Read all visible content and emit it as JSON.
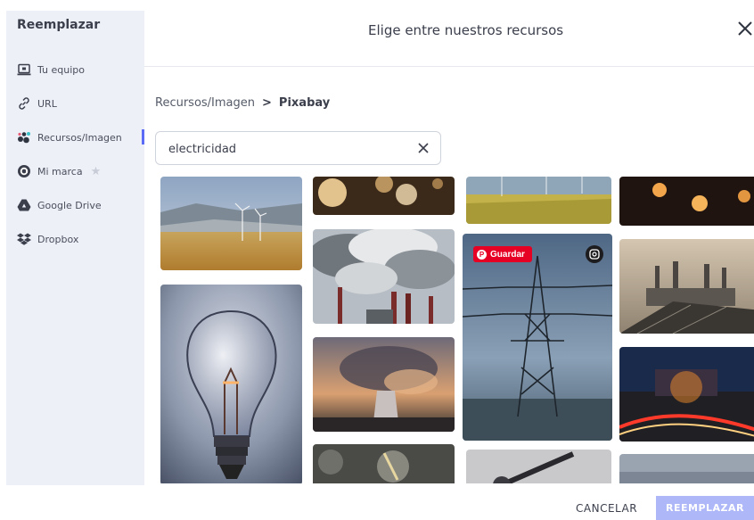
{
  "sidebar": {
    "title": "Reemplazar",
    "items": [
      {
        "label": "Tu equipo",
        "icon": "laptop-icon"
      },
      {
        "label": "URL",
        "icon": "link-icon"
      },
      {
        "label": "Recursos/Imagen",
        "icon": "dots-icon",
        "active": true
      },
      {
        "label": "Mi marca",
        "icon": "brand-icon",
        "badge": "star-icon"
      },
      {
        "label": "Google Drive",
        "icon": "google-drive-icon"
      },
      {
        "label": "Dropbox",
        "icon": "dropbox-icon"
      }
    ]
  },
  "header": {
    "title": "Elige entre nuestros recursos",
    "close_icon": "close-icon"
  },
  "breadcrumb": {
    "parent": "Recursos/Imagen",
    "separator": ">",
    "current": "Pixabay"
  },
  "search": {
    "value": "electricidad",
    "clear_icon": "clear-icon"
  },
  "grid": {
    "pinterest_label": "Guardar",
    "visual_search_icon": "visual-search-icon"
  },
  "footer": {
    "cancel_label": "CANCELAR",
    "replace_label": "REEMPLAZAR"
  },
  "colors": {
    "accent": "#5b6bf5",
    "replace_disabled": "#aeb7f7",
    "pinterest": "#e60023",
    "sidebar_bg": "#eef0f8"
  }
}
